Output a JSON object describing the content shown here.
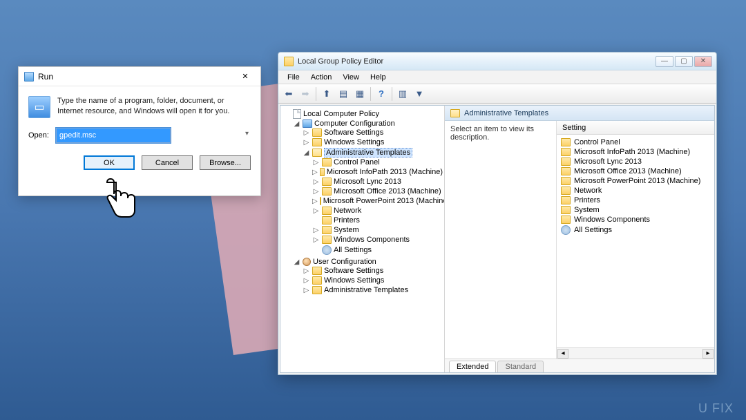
{
  "run": {
    "title": "Run",
    "description": "Type the name of a program, folder, document, or Internet resource, and Windows will open it for you.",
    "open_label": "Open:",
    "input_value": "gpedit.msc",
    "ok": "OK",
    "cancel": "Cancel",
    "browse": "Browse..."
  },
  "gp": {
    "title": "Local Group Policy Editor",
    "menu": {
      "file": "File",
      "action": "Action",
      "view": "View",
      "help": "Help"
    },
    "tree_root": "Local Computer Policy",
    "comp_cfg": "Computer Configuration",
    "software_settings": "Software Settings",
    "windows_settings": "Windows Settings",
    "admin_templates": "Administrative Templates",
    "at_children": [
      "Control Panel",
      "Microsoft InfoPath 2013 (Machine)",
      "Microsoft Lync 2013",
      "Microsoft Office 2013 (Machine)",
      "Microsoft PowerPoint 2013 (Machine)",
      "Network",
      "Printers",
      "System",
      "Windows Components",
      "All Settings"
    ],
    "user_cfg": "User Configuration",
    "uc_children": [
      "Software Settings",
      "Windows Settings",
      "Administrative Templates"
    ],
    "detail_heading": "Administrative Templates",
    "detail_hint": "Select an item to view its description.",
    "setting_col": "Setting",
    "settings": [
      "Control Panel",
      "Microsoft InfoPath 2013 (Machine)",
      "Microsoft Lync 2013",
      "Microsoft Office 2013 (Machine)",
      "Microsoft PowerPoint 2013 (Machine)",
      "Network",
      "Printers",
      "System",
      "Windows Components",
      "All Settings"
    ],
    "tab_extended": "Extended",
    "tab_standard": "Standard"
  },
  "watermark": "U    FIX"
}
